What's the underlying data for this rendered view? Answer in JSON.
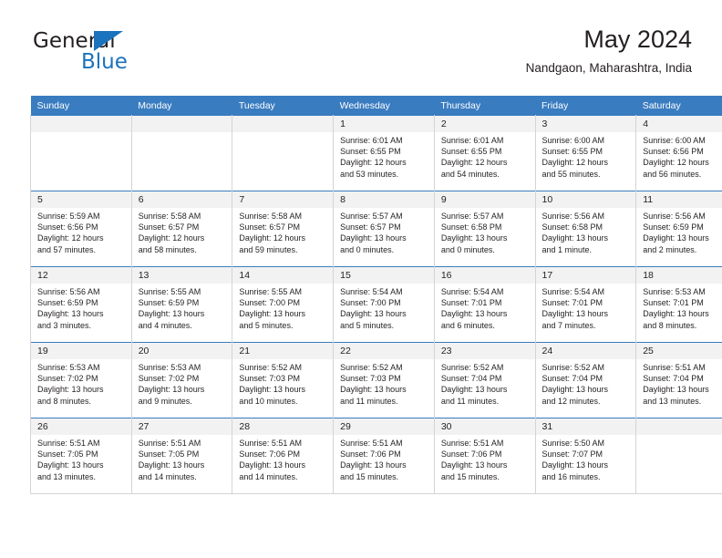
{
  "brand": {
    "name_top": "General",
    "name_bottom": "Blue",
    "accent_color": "#1b72bd"
  },
  "header": {
    "title": "May 2024",
    "subtitle": "Nandgaon, Maharashtra, India"
  },
  "calendar": {
    "header_bg": "#3a7cc0",
    "daynum_bg": "#f2f2f2",
    "weekday_headers": [
      "Sunday",
      "Monday",
      "Tuesday",
      "Wednesday",
      "Thursday",
      "Friday",
      "Saturday"
    ],
    "weeks": [
      [
        {
          "day": "",
          "empty": true
        },
        {
          "day": "",
          "empty": true
        },
        {
          "day": "",
          "empty": true
        },
        {
          "day": "1",
          "sunrise": "Sunrise: 6:01 AM",
          "sunset": "Sunset: 6:55 PM",
          "daylight1": "Daylight: 12 hours",
          "daylight2": "and 53 minutes."
        },
        {
          "day": "2",
          "sunrise": "Sunrise: 6:01 AM",
          "sunset": "Sunset: 6:55 PM",
          "daylight1": "Daylight: 12 hours",
          "daylight2": "and 54 minutes."
        },
        {
          "day": "3",
          "sunrise": "Sunrise: 6:00 AM",
          "sunset": "Sunset: 6:55 PM",
          "daylight1": "Daylight: 12 hours",
          "daylight2": "and 55 minutes."
        },
        {
          "day": "4",
          "sunrise": "Sunrise: 6:00 AM",
          "sunset": "Sunset: 6:56 PM",
          "daylight1": "Daylight: 12 hours",
          "daylight2": "and 56 minutes."
        }
      ],
      [
        {
          "day": "5",
          "sunrise": "Sunrise: 5:59 AM",
          "sunset": "Sunset: 6:56 PM",
          "daylight1": "Daylight: 12 hours",
          "daylight2": "and 57 minutes."
        },
        {
          "day": "6",
          "sunrise": "Sunrise: 5:58 AM",
          "sunset": "Sunset: 6:57 PM",
          "daylight1": "Daylight: 12 hours",
          "daylight2": "and 58 minutes."
        },
        {
          "day": "7",
          "sunrise": "Sunrise: 5:58 AM",
          "sunset": "Sunset: 6:57 PM",
          "daylight1": "Daylight: 12 hours",
          "daylight2": "and 59 minutes."
        },
        {
          "day": "8",
          "sunrise": "Sunrise: 5:57 AM",
          "sunset": "Sunset: 6:57 PM",
          "daylight1": "Daylight: 13 hours",
          "daylight2": "and 0 minutes."
        },
        {
          "day": "9",
          "sunrise": "Sunrise: 5:57 AM",
          "sunset": "Sunset: 6:58 PM",
          "daylight1": "Daylight: 13 hours",
          "daylight2": "and 0 minutes."
        },
        {
          "day": "10",
          "sunrise": "Sunrise: 5:56 AM",
          "sunset": "Sunset: 6:58 PM",
          "daylight1": "Daylight: 13 hours",
          "daylight2": "and 1 minute."
        },
        {
          "day": "11",
          "sunrise": "Sunrise: 5:56 AM",
          "sunset": "Sunset: 6:59 PM",
          "daylight1": "Daylight: 13 hours",
          "daylight2": "and 2 minutes."
        }
      ],
      [
        {
          "day": "12",
          "sunrise": "Sunrise: 5:56 AM",
          "sunset": "Sunset: 6:59 PM",
          "daylight1": "Daylight: 13 hours",
          "daylight2": "and 3 minutes."
        },
        {
          "day": "13",
          "sunrise": "Sunrise: 5:55 AM",
          "sunset": "Sunset: 6:59 PM",
          "daylight1": "Daylight: 13 hours",
          "daylight2": "and 4 minutes."
        },
        {
          "day": "14",
          "sunrise": "Sunrise: 5:55 AM",
          "sunset": "Sunset: 7:00 PM",
          "daylight1": "Daylight: 13 hours",
          "daylight2": "and 5 minutes."
        },
        {
          "day": "15",
          "sunrise": "Sunrise: 5:54 AM",
          "sunset": "Sunset: 7:00 PM",
          "daylight1": "Daylight: 13 hours",
          "daylight2": "and 5 minutes."
        },
        {
          "day": "16",
          "sunrise": "Sunrise: 5:54 AM",
          "sunset": "Sunset: 7:01 PM",
          "daylight1": "Daylight: 13 hours",
          "daylight2": "and 6 minutes."
        },
        {
          "day": "17",
          "sunrise": "Sunrise: 5:54 AM",
          "sunset": "Sunset: 7:01 PM",
          "daylight1": "Daylight: 13 hours",
          "daylight2": "and 7 minutes."
        },
        {
          "day": "18",
          "sunrise": "Sunrise: 5:53 AM",
          "sunset": "Sunset: 7:01 PM",
          "daylight1": "Daylight: 13 hours",
          "daylight2": "and 8 minutes."
        }
      ],
      [
        {
          "day": "19",
          "sunrise": "Sunrise: 5:53 AM",
          "sunset": "Sunset: 7:02 PM",
          "daylight1": "Daylight: 13 hours",
          "daylight2": "and 8 minutes."
        },
        {
          "day": "20",
          "sunrise": "Sunrise: 5:53 AM",
          "sunset": "Sunset: 7:02 PM",
          "daylight1": "Daylight: 13 hours",
          "daylight2": "and 9 minutes."
        },
        {
          "day": "21",
          "sunrise": "Sunrise: 5:52 AM",
          "sunset": "Sunset: 7:03 PM",
          "daylight1": "Daylight: 13 hours",
          "daylight2": "and 10 minutes."
        },
        {
          "day": "22",
          "sunrise": "Sunrise: 5:52 AM",
          "sunset": "Sunset: 7:03 PM",
          "daylight1": "Daylight: 13 hours",
          "daylight2": "and 11 minutes."
        },
        {
          "day": "23",
          "sunrise": "Sunrise: 5:52 AM",
          "sunset": "Sunset: 7:04 PM",
          "daylight1": "Daylight: 13 hours",
          "daylight2": "and 11 minutes."
        },
        {
          "day": "24",
          "sunrise": "Sunrise: 5:52 AM",
          "sunset": "Sunset: 7:04 PM",
          "daylight1": "Daylight: 13 hours",
          "daylight2": "and 12 minutes."
        },
        {
          "day": "25",
          "sunrise": "Sunrise: 5:51 AM",
          "sunset": "Sunset: 7:04 PM",
          "daylight1": "Daylight: 13 hours",
          "daylight2": "and 13 minutes."
        }
      ],
      [
        {
          "day": "26",
          "sunrise": "Sunrise: 5:51 AM",
          "sunset": "Sunset: 7:05 PM",
          "daylight1": "Daylight: 13 hours",
          "daylight2": "and 13 minutes."
        },
        {
          "day": "27",
          "sunrise": "Sunrise: 5:51 AM",
          "sunset": "Sunset: 7:05 PM",
          "daylight1": "Daylight: 13 hours",
          "daylight2": "and 14 minutes."
        },
        {
          "day": "28",
          "sunrise": "Sunrise: 5:51 AM",
          "sunset": "Sunset: 7:06 PM",
          "daylight1": "Daylight: 13 hours",
          "daylight2": "and 14 minutes."
        },
        {
          "day": "29",
          "sunrise": "Sunrise: 5:51 AM",
          "sunset": "Sunset: 7:06 PM",
          "daylight1": "Daylight: 13 hours",
          "daylight2": "and 15 minutes."
        },
        {
          "day": "30",
          "sunrise": "Sunrise: 5:51 AM",
          "sunset": "Sunset: 7:06 PM",
          "daylight1": "Daylight: 13 hours",
          "daylight2": "and 15 minutes."
        },
        {
          "day": "31",
          "sunrise": "Sunrise: 5:50 AM",
          "sunset": "Sunset: 7:07 PM",
          "daylight1": "Daylight: 13 hours",
          "daylight2": "and 16 minutes."
        },
        {
          "day": "",
          "empty": true
        }
      ]
    ]
  }
}
